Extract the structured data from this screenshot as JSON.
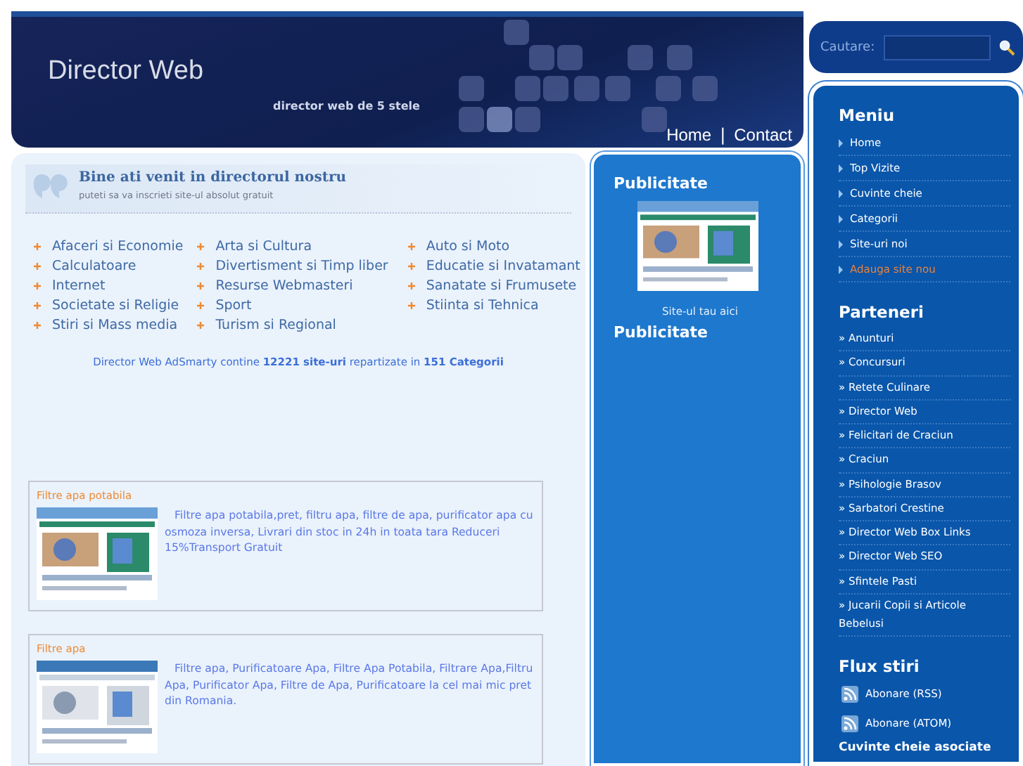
{
  "header": {
    "title": "Director Web",
    "tagline": "director web de 5 stele",
    "nav": [
      {
        "label": "Home"
      },
      {
        "label": "|"
      },
      {
        "label": "Contact"
      }
    ]
  },
  "search": {
    "label": "Cautare:"
  },
  "welcome": {
    "title": "Bine ati venit in directorul nostru",
    "subtitle": "puteti sa va inscrieti site-ul absolut gratuit"
  },
  "categories": [
    [
      "Afaceri si Economie",
      "Calculatoare",
      "Internet",
      "Societate si Religie",
      "Stiri si Mass media"
    ],
    [
      "Arta si Cultura",
      "Divertisment si Timp liber",
      "Resurse Webmasteri",
      "Sport",
      "Turism si Regional"
    ],
    [
      "Auto si Moto",
      "Educatie si Invatamant",
      "Sanatate si Frumusete",
      "Stiinta si Tehnica"
    ]
  ],
  "stats": "Director Web AdSmarty contine **12221 site-uri** repartizate in **151 Categorii**",
  "listings": [
    {
      "title": "Filtre apa potabila",
      "description": "Filtre apa potabila,pret, filtru apa, filtre de apa, purificator apa cu osmoza inversa, Livrari din stoc in 24h in toata tara Reduceri 15%Transport Gratuit"
    },
    {
      "title": "Filtre apa",
      "description": "Filtre apa, Purificatoare Apa, Filtre Apa Potabila, Filtrare Apa,Filtru Apa, Purificator Apa, Filtre de Apa, Purificatoare la cel mai mic pret din Romania."
    }
  ],
  "ads": {
    "heading": "Publicitate",
    "caption": "Site-ul tau aici",
    "heading_2": "Publicitate"
  },
  "menu": {
    "heading": "Meniu",
    "items": [
      {
        "label": "Home",
        "selected": false
      },
      {
        "label": "Top Vizite",
        "selected": false
      },
      {
        "label": "Cuvinte cheie",
        "selected": false
      },
      {
        "label": "Categorii",
        "selected": false
      },
      {
        "label": "Site-uri noi",
        "selected": false
      },
      {
        "label": "Adauga site nou",
        "selected": true
      }
    ]
  },
  "partners": {
    "heading": "Parteneri",
    "items": [
      "» Anunturi",
      "» Concursuri",
      "» Retete Culinare",
      "» Director Web",
      "» Felicitari de Craciun",
      "» Craciun",
      "» Psihologie Brasov",
      "» Sarbatori Crestine",
      "» Director Web Box Links",
      "» Director Web SEO",
      "» Sfintele Pasti",
      "» Jucarii Copii si Articole Bebelusi"
    ]
  },
  "feeds": {
    "heading": "Flux stiri",
    "items": [
      "Abonare (RSS)",
      "Abonare (ATOM)"
    ]
  },
  "keywords": {
    "heading": "Cuvinte cheie asociate"
  }
}
